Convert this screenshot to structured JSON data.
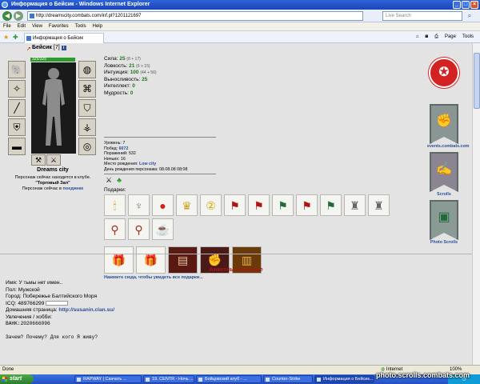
{
  "window": {
    "title": "Информация о Бейсик - Windows Internet Explorer"
  },
  "address": {
    "url": "http://dreamscity.combats.com/inf.pl?1201121697",
    "search_placeholder": "Live Search"
  },
  "menu": [
    "File",
    "Edit",
    "View",
    "Favorites",
    "Tools",
    "Help"
  ],
  "tab": {
    "label": "Информация о Бейсик"
  },
  "toolbar": {
    "page_label": "Page",
    "tools_label": "Tools"
  },
  "character": {
    "name": "Бейсик",
    "level": "[7]",
    "info_badge": "i",
    "hp_text": "325/325",
    "hp_fraction": 1.0,
    "club_name": "Dreams city",
    "location_line": "Персонаж сейчас находится в клубе.",
    "location_room": "\"Торговый Зал\"",
    "activity_prefix": "Персонаж сейчас в",
    "activity_value": "поединке"
  },
  "equipment_icons": [
    "earrings-icon",
    "amulet-icon",
    "sword-icon",
    "axe-icon",
    "armor-icon",
    "belt-icon",
    "helmet-icon",
    "bracer-icon",
    "glove-icon",
    "shield-icon",
    "boots-icon",
    "ring-icon",
    "mace-icon",
    "dagger-icon"
  ],
  "stats": [
    {
      "label": "Сила:",
      "value": "25",
      "extra": "(8 + 17)"
    },
    {
      "label": "Ловкость:",
      "value": "21",
      "extra": "(6 + 15)"
    },
    {
      "label": "Интуиция:",
      "value": "100",
      "extra": "(44 + 56)"
    },
    {
      "label": "Выносливость:",
      "value": "25",
      "extra": ""
    },
    {
      "label": "Интеллект:",
      "value": "0",
      "extra": ""
    },
    {
      "label": "Мудрость:",
      "value": "0",
      "extra": ""
    }
  ],
  "meta": [
    {
      "label": "Уровень:",
      "value": "7"
    },
    {
      "label": "Побед:",
      "value": "6072"
    },
    {
      "label": "Поражений:",
      "value": "532"
    },
    {
      "label": "Ничьих:",
      "value": "16"
    },
    {
      "label": "Место рождения:",
      "value": "Low city"
    },
    {
      "label": "День рождения персонажа:",
      "value": "08.08.08 08:08"
    }
  ],
  "badge_icons": [
    "crossed-swords-icon",
    "clover-icon"
  ],
  "gifts": {
    "title": "Подарки:",
    "row1": [
      "candle-icon",
      "chalice-icon",
      "crystal-ball-icon",
      "trophy-icon",
      "number-two-icon",
      "red-banner-icon",
      "red-banner-icon",
      "green-banner-icon",
      "red-banner-icon",
      "green-banner-icon",
      "statue-icon",
      "statue-icon"
    ],
    "row2": [
      "mace-icon",
      "mace-icon",
      "mug-icon"
    ],
    "row3": [
      "gift-box-icon",
      "gift-box-icon",
      "book-icon",
      "book-icon",
      "book-icon"
    ],
    "link": "Нажмите сюда, чтобы увидеть все подарки..."
  },
  "sidebar": {
    "events_label": "events.combats.com",
    "scrolls_label": "Scrolls",
    "photo_scrolls_label": "Photo Scrolls"
  },
  "profile": {
    "section_title": "Анкетные данные",
    "name_line": "Имя: У тьмы нет имен..",
    "gender_line": "Пол: Мужской",
    "city_line": "Город: Побережье Балтийского Моря",
    "icq_line": "ICQ: 489766299",
    "home_label": "Домашняя страница:",
    "home_url": "http://susanin.clan.su/",
    "hobby_line": "Увлечения / хобби:",
    "bank_line": "BAHK:2020666096",
    "motto_line": "Зачем? Почему? Для кого Я живу?"
  },
  "statusbar": {
    "done": "Done",
    "zone": "Internet",
    "zoom": "100%"
  },
  "taskbar": {
    "start": "start",
    "tasks": [
      "RAPWAY | Скачать ...",
      "19. CENTR - Ночь ...",
      "Бойцовский клуб - ...",
      "Counter-Strike",
      "Информация о Бейсик..."
    ]
  },
  "watermark": "photo.scrolls.combats.com"
}
